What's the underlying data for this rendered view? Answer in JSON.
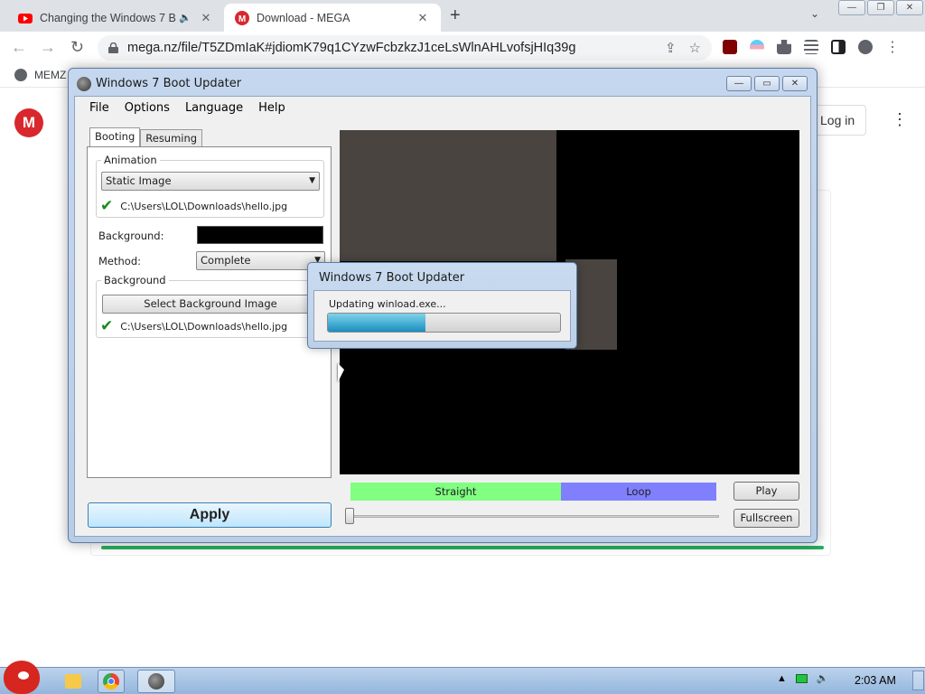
{
  "browser": {
    "tabs": [
      {
        "title": "Changing the Windows 7 B",
        "audio": "🔈"
      },
      {
        "title": "Download - MEGA"
      }
    ],
    "new_tab": "+",
    "url": "mega.nz/file/T5ZDmIaK#jdiomK79q1CYzwFcbzkzJ1ceLsWlnAHLvofsjHIq39g",
    "bookmark": "MEMZ",
    "colors": {
      "mega_red": "#d9272e",
      "chrome_bar": "#dee1e6"
    }
  },
  "page": {
    "logo": "M",
    "login_label": "Log in",
    "menu_icon": "⋮"
  },
  "app": {
    "title": "Windows 7 Boot Updater",
    "menu": [
      "File",
      "Options",
      "Language",
      "Help"
    ],
    "tabs": [
      "Booting",
      "Resuming"
    ],
    "animation_group": "Animation",
    "animation_value": "Static Image",
    "animation_path": "C:\\Users\\LOL\\Downloads\\hello.jpg",
    "background_label": "Background:",
    "background_color": "#000000",
    "method_label": "Method:",
    "method_value": "Complete",
    "bg_group": "Background",
    "select_bg_button": "Select Background Image",
    "bg_path": "C:\\Users\\LOL\\Downloads\\hello.jpg",
    "apply_button": "Apply",
    "segments": {
      "straight": "Straight",
      "loop": "Loop"
    },
    "play_button": "Play",
    "fullscreen_button": "Fullscreen",
    "colors": {
      "straight": "#80ff80",
      "loop": "#8080ff"
    }
  },
  "dialog": {
    "title": "Windows 7 Boot Updater",
    "status": "Updating winload.exe...",
    "progress": 0.42
  },
  "taskbar": {
    "clock": "2:03 AM"
  }
}
